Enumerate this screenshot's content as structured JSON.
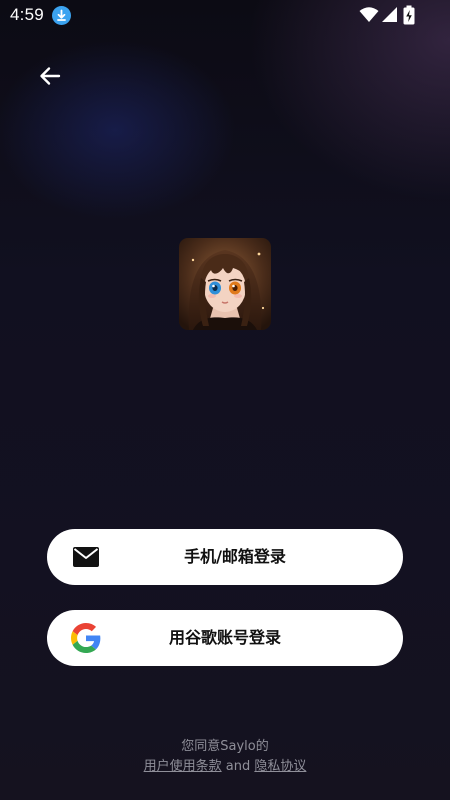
{
  "status_bar": {
    "time": "4:59",
    "icons": [
      "download-icon",
      "wifi-icon",
      "signal-icon",
      "battery-charging-icon"
    ]
  },
  "nav": {
    "back_icon": "arrow-left-icon"
  },
  "avatar": {
    "icon": "character-avatar"
  },
  "buttons": {
    "phone_email_label": "手机/邮箱登录",
    "phone_email_icon": "mail-icon",
    "google_label": "用谷歌账号登录",
    "google_icon": "google-g-icon"
  },
  "agreement": {
    "line1": "您同意Saylo的",
    "terms_link": "用户使用条款",
    "and_text": "and",
    "privacy_link": "隐私协议"
  },
  "colors": {
    "download_badge": "#3ba3f0",
    "button_bg": "#ffffff",
    "agreement_text": "#8f8f99"
  }
}
